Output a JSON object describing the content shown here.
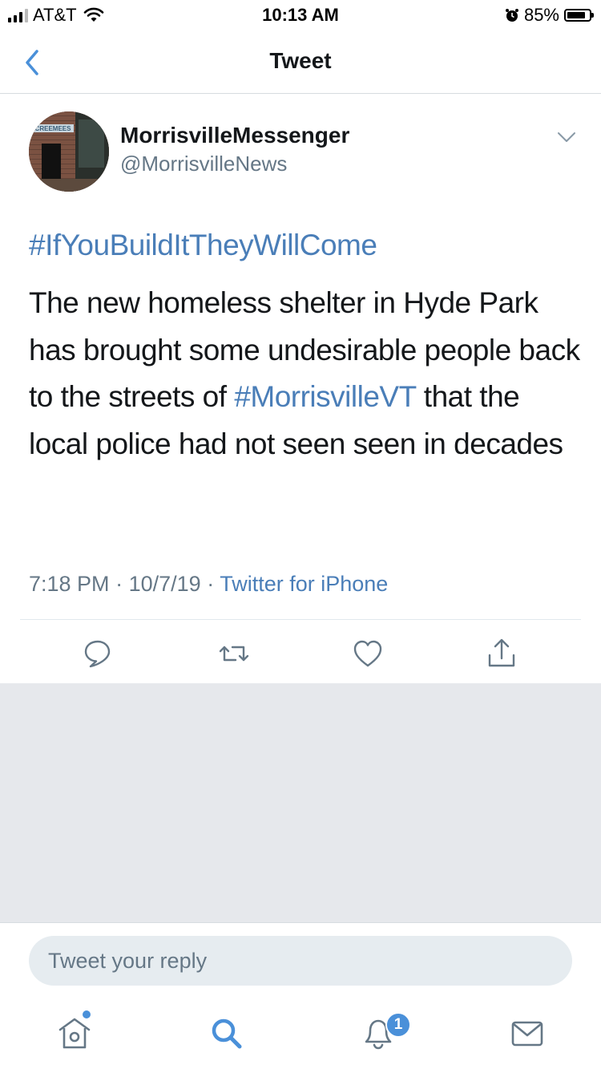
{
  "status_bar": {
    "carrier": "AT&T",
    "time": "10:13 AM",
    "battery_percent": "85%",
    "battery_level": 0.85,
    "icons": [
      "signal-icon",
      "wifi-icon",
      "alarm-icon",
      "battery-icon"
    ]
  },
  "nav": {
    "title": "Tweet",
    "back_icon": "chevron-left-icon"
  },
  "tweet": {
    "author_name": "MorrisvilleMessenger",
    "author_handle": "@MorrisvilleNews",
    "avatar_text": "CREEMEES",
    "hashtag_line": "#IfYouBuildItTheyWillCome",
    "body_part1": "The new homeless shelter in Hyde Park has brought some undesirable people back to the streets of ",
    "body_hashtag": "#MorrisvilleVT",
    "body_part2": " that the local police had not seen seen in decades",
    "time": "7:18 PM",
    "date": "10/7/19",
    "separator": "·",
    "source": "Twitter for iPhone"
  },
  "actions": [
    "reply-icon",
    "retweet-icon",
    "like-icon",
    "share-icon"
  ],
  "reply": {
    "placeholder": "Tweet your reply"
  },
  "tab_bar": {
    "tabs": [
      "home-icon",
      "search-icon",
      "notifications-icon",
      "messages-icon"
    ],
    "notifications_badge": "1"
  },
  "colors": {
    "link": "#4a7eb8",
    "secondary_text": "#657786",
    "background_gray": "#e6e8ec",
    "badge": "#4a90d9"
  }
}
